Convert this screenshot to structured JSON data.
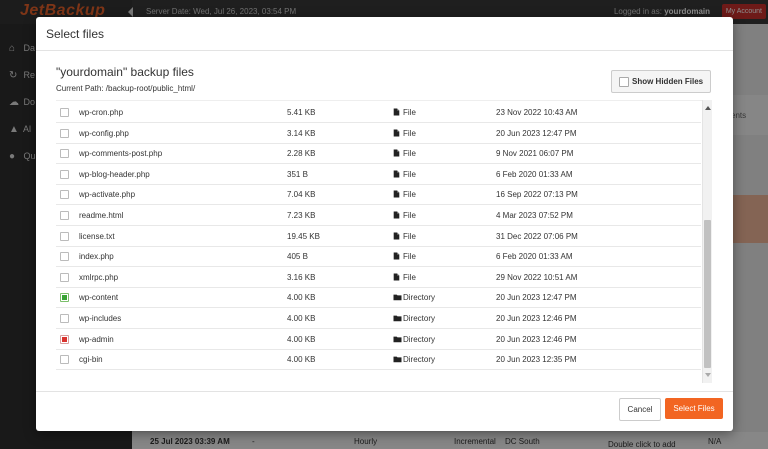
{
  "app": {
    "logo": "JetBackup",
    "server_date": "Server Date: Wed, Jul 26, 2023, 03:54 PM",
    "logged_in_prefix": "Logged in as:",
    "logged_in_user": "yourdomain",
    "my_account": "My Account",
    "sidebar": [
      {
        "label": "Da",
        "icon": "home-icon"
      },
      {
        "label": "Re",
        "icon": "restore-icon"
      },
      {
        "label": "Do",
        "icon": "cloud-download-icon"
      },
      {
        "label": "Al",
        "icon": "alert-icon"
      },
      {
        "label": "Qu",
        "icon": "question-icon"
      }
    ],
    "right_partial_label": "ents",
    "bottom_row": {
      "date": "25 Jul 2023 03:39 AM",
      "dash": "-",
      "frequency": "Hourly",
      "type": "Incremental",
      "destination": "DC South",
      "action": "Double click to add",
      "na": "N/A"
    }
  },
  "modal": {
    "title": "Select files",
    "files_title": "\"yourdomain\" backup files",
    "current_path": "Current Path: /backup-root/public_html/",
    "show_hidden_label": "Show Hidden Files",
    "cancel_label": "Cancel",
    "select_label": "Select Files",
    "files": [
      {
        "name": "wp-cron.php",
        "size": "5.41 KB",
        "type": "File",
        "date": "23 Nov 2022 10:43 AM",
        "state": "none"
      },
      {
        "name": "wp-config.php",
        "size": "3.14 KB",
        "type": "File",
        "date": "20 Jun 2023 12:47 PM",
        "state": "none"
      },
      {
        "name": "wp-comments-post.php",
        "size": "2.28 KB",
        "type": "File",
        "date": "9 Nov 2021 06:07 PM",
        "state": "none"
      },
      {
        "name": "wp-blog-header.php",
        "size": "351 B",
        "type": "File",
        "date": "6 Feb 2020 01:33 AM",
        "state": "none"
      },
      {
        "name": "wp-activate.php",
        "size": "7.04 KB",
        "type": "File",
        "date": "16 Sep 2022 07:13 PM",
        "state": "none"
      },
      {
        "name": "readme.html",
        "size": "7.23 KB",
        "type": "File",
        "date": "4 Mar 2023 07:52 PM",
        "state": "none"
      },
      {
        "name": "license.txt",
        "size": "19.45 KB",
        "type": "File",
        "date": "31 Dec 2022 07:06 PM",
        "state": "none"
      },
      {
        "name": "index.php",
        "size": "405 B",
        "type": "File",
        "date": "6 Feb 2020 01:33 AM",
        "state": "none"
      },
      {
        "name": "xmlrpc.php",
        "size": "3.16 KB",
        "type": "File",
        "date": "29 Nov 2022 10:51 AM",
        "state": "none"
      },
      {
        "name": "wp-content",
        "size": "4.00 KB",
        "type": "Directory",
        "date": "20 Jun 2023 12:47 PM",
        "state": "green"
      },
      {
        "name": "wp-includes",
        "size": "4.00 KB",
        "type": "Directory",
        "date": "20 Jun 2023 12:46 PM",
        "state": "none"
      },
      {
        "name": "wp-admin",
        "size": "4.00 KB",
        "type": "Directory",
        "date": "20 Jun 2023 12:46 PM",
        "state": "red"
      },
      {
        "name": "cgi-bin",
        "size": "4.00 KB",
        "type": "Directory",
        "date": "20 Jun 2023 12:35 PM",
        "state": "none"
      }
    ]
  },
  "colors": {
    "accent": "#f26522",
    "brand_logo": "#e8622a",
    "checked_green": "#3aa335",
    "checked_red": "#d9332e"
  }
}
